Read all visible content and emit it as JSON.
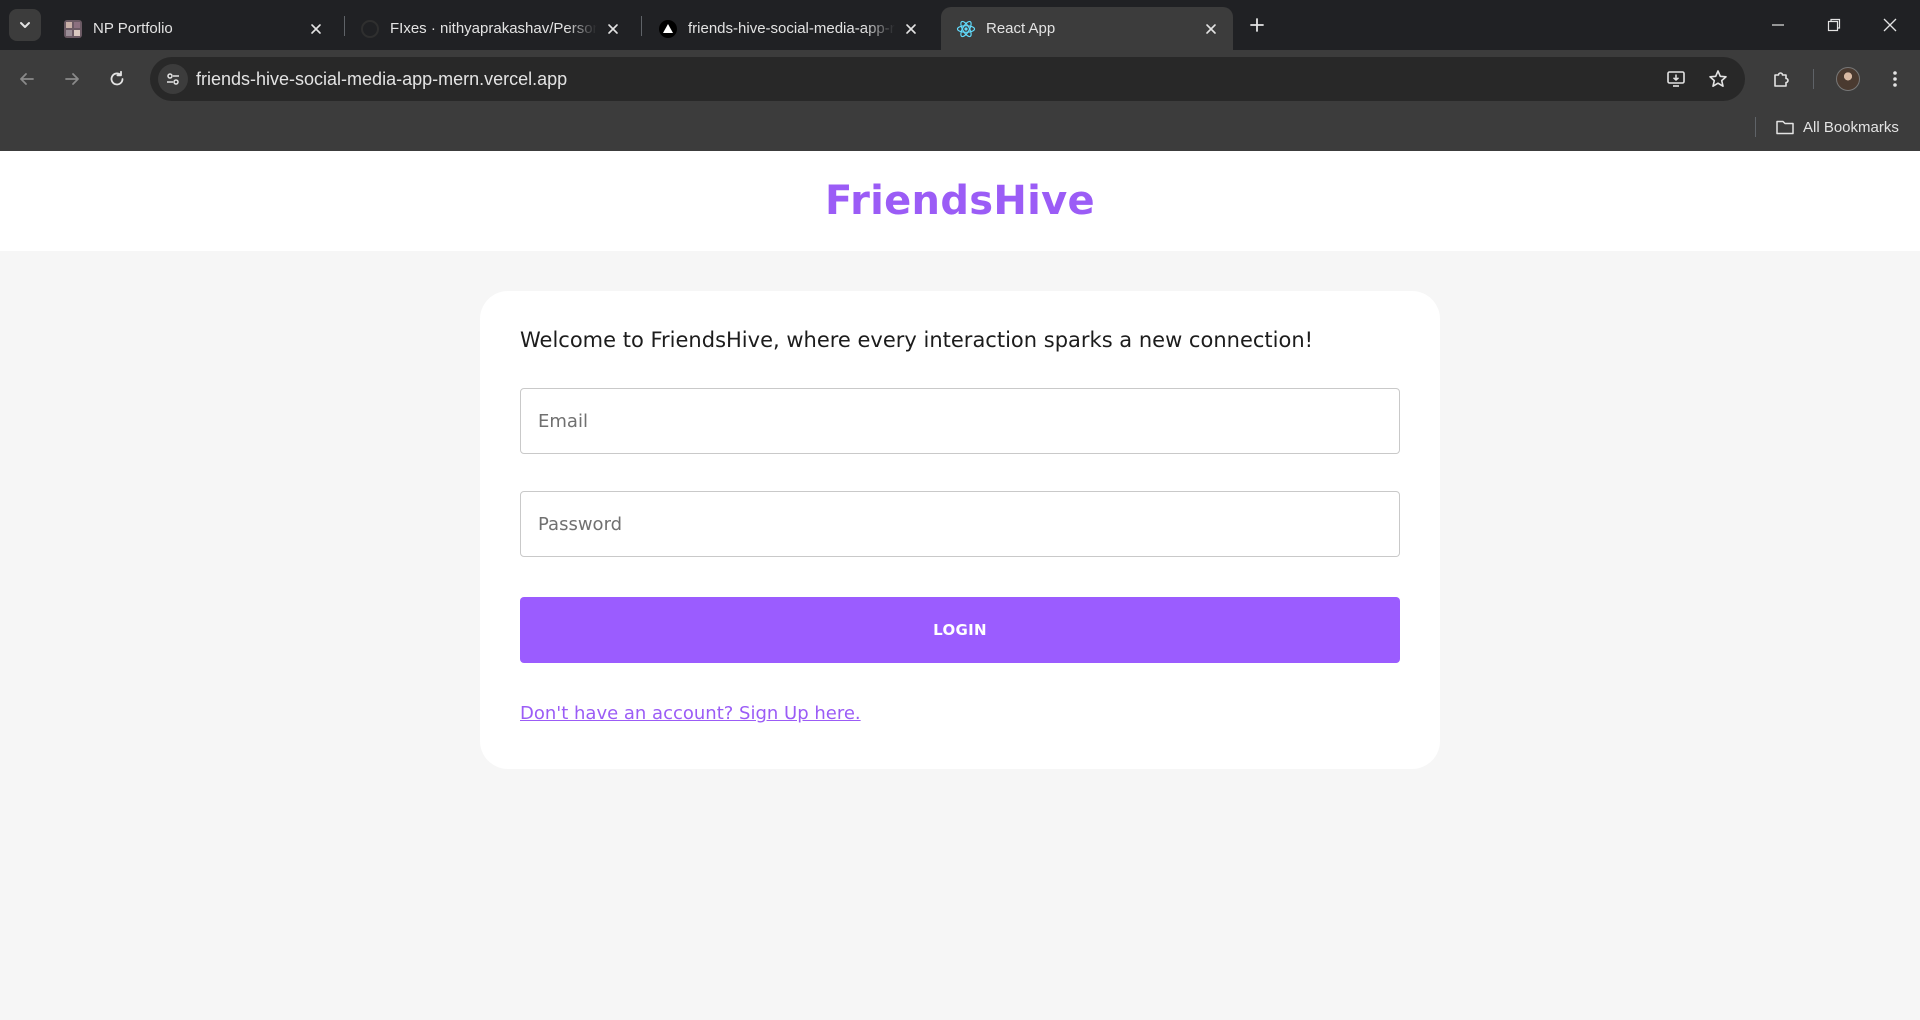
{
  "browser": {
    "tabs": [
      {
        "title": "NP Portfolio",
        "favicon": "portfolio-favicon-icon",
        "active": false
      },
      {
        "title": "FIxes · nithyaprakashav/Persona",
        "favicon": "github-favicon-icon",
        "active": false
      },
      {
        "title": "friends-hive-social-media-app-r",
        "favicon": "vercel-favicon-icon",
        "active": false
      },
      {
        "title": "React App",
        "favicon": "react-favicon-icon",
        "active": true
      }
    ],
    "url": "friends-hive-social-media-app-mern.vercel.app",
    "bookmarks_label": "All Bookmarks"
  },
  "colors": {
    "brand": "#9b5cf6",
    "button": "#9b5cff",
    "page_bg": "#f6f6f6",
    "card_bg": "#ffffff",
    "chrome_dark": "#202124",
    "chrome_toolbar": "#3c3c3c"
  },
  "page": {
    "brand_title": "FriendsHive",
    "welcome_text": "Welcome to FriendsHive, where every interaction sparks a new connection!",
    "email_placeholder": "Email",
    "password_placeholder": "Password",
    "login_label": "LOGIN",
    "signup_link": "Don't have an account? Sign Up here."
  }
}
